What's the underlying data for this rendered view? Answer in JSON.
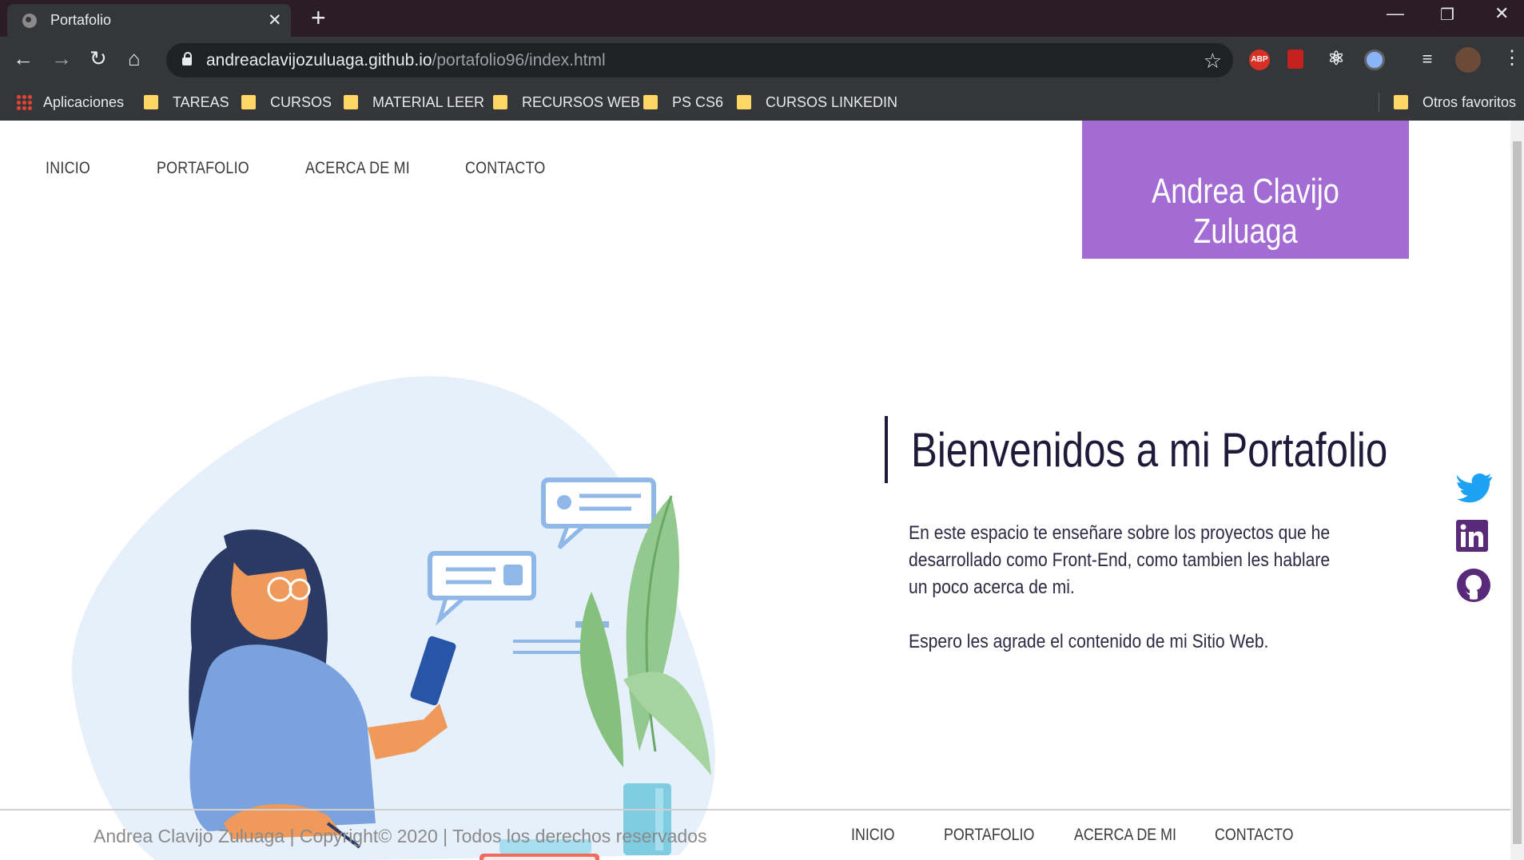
{
  "browser": {
    "tab_title": "Portafolio",
    "url_host": "andreaclavijozuluaga.github.io",
    "url_path": "/portafolio96/index.html",
    "abp_label": "ABP",
    "bookmarks": [
      "Aplicaciones",
      "TAREAS",
      "CURSOS",
      "MATERIAL LEER",
      "RECURSOS WEB",
      "PS CS6",
      "CURSOS LINKEDIN"
    ],
    "other_bookmarks": "Otros favoritos"
  },
  "nav": {
    "items": [
      "INICIO",
      "PORTAFOLIO",
      "ACERCA DE MI",
      "CONTACTO"
    ]
  },
  "brand": {
    "name": "Andrea Clavijo Zuluaga",
    "color": "#a36bd4"
  },
  "hero": {
    "title": "Bienvenidos a mi Portafolio",
    "paragraph1": "En este espacio te enseñare sobre los proyectos que he desarrollado como Front-End, como tambien les hablare un poco acerca de mi.",
    "paragraph2": "Espero les agrade el contenido de mi Sitio Web."
  },
  "social": {
    "icons": [
      "twitter-icon",
      "linkedin-icon",
      "github-icon"
    ],
    "twitter_color": "#1da1f2",
    "brand_color": "#5a2a7a"
  },
  "footer": {
    "copyright": "Andrea Clavijo Zuluaga | Copyright© 2020 | Todos los derechos reservados",
    "links": [
      "INICIO",
      "PORTAFOLIO",
      "ACERCA DE MI",
      "CONTACTO"
    ]
  }
}
